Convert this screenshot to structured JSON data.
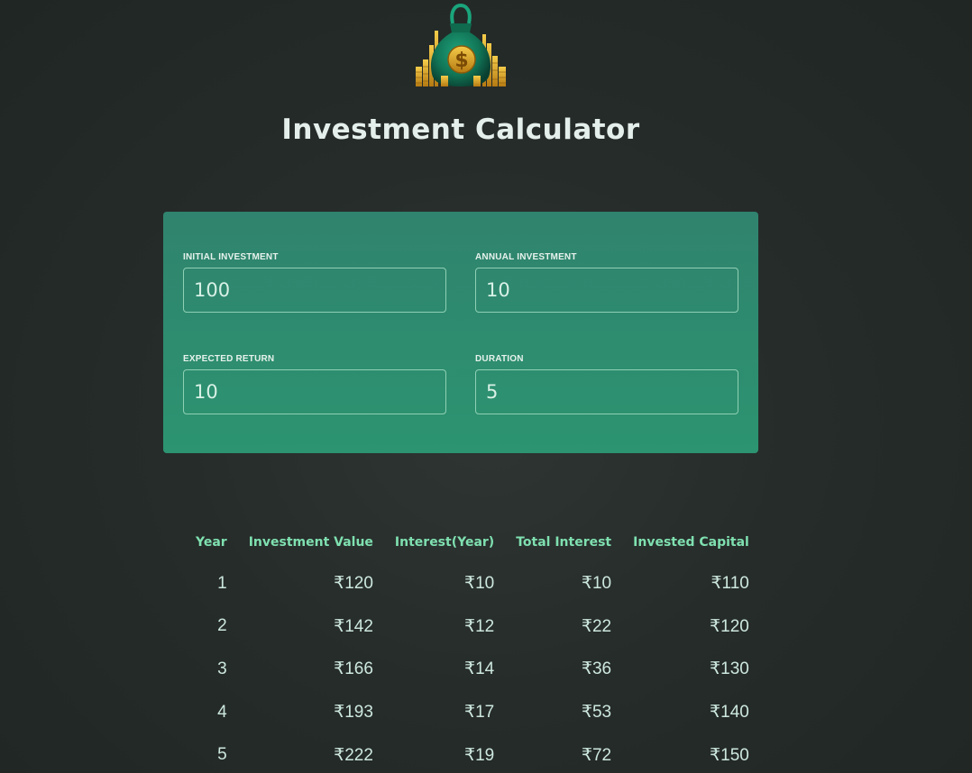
{
  "app": {
    "title": "Investment Calculator"
  },
  "form": {
    "initial_investment": {
      "label": "Initial Investment",
      "value": "100"
    },
    "annual_investment": {
      "label": "Annual Investment",
      "value": "10"
    },
    "expected_return": {
      "label": "Expected Return",
      "value": "10"
    },
    "duration": {
      "label": "Duration",
      "value": "5"
    }
  },
  "table": {
    "headers": [
      "Year",
      "Investment Value",
      "Interest(Year)",
      "Total Interest",
      "Invested Capital"
    ],
    "rows": [
      [
        "1",
        "₹120",
        "₹10",
        "₹10",
        "₹110"
      ],
      [
        "2",
        "₹142",
        "₹12",
        "₹22",
        "₹120"
      ],
      [
        "3",
        "₹166",
        "₹14",
        "₹36",
        "₹130"
      ],
      [
        "4",
        "₹193",
        "₹17",
        "₹53",
        "₹140"
      ],
      [
        "5",
        "₹222",
        "₹19",
        "₹72",
        "₹150"
      ]
    ]
  },
  "colors": {
    "background": "#262c2a",
    "panel_top": "#30836e",
    "panel_bottom": "#2c9470",
    "header_accent": "#7fe0b0",
    "text": "#cde8de"
  },
  "icons": {
    "logo": "money-bag-icon"
  }
}
